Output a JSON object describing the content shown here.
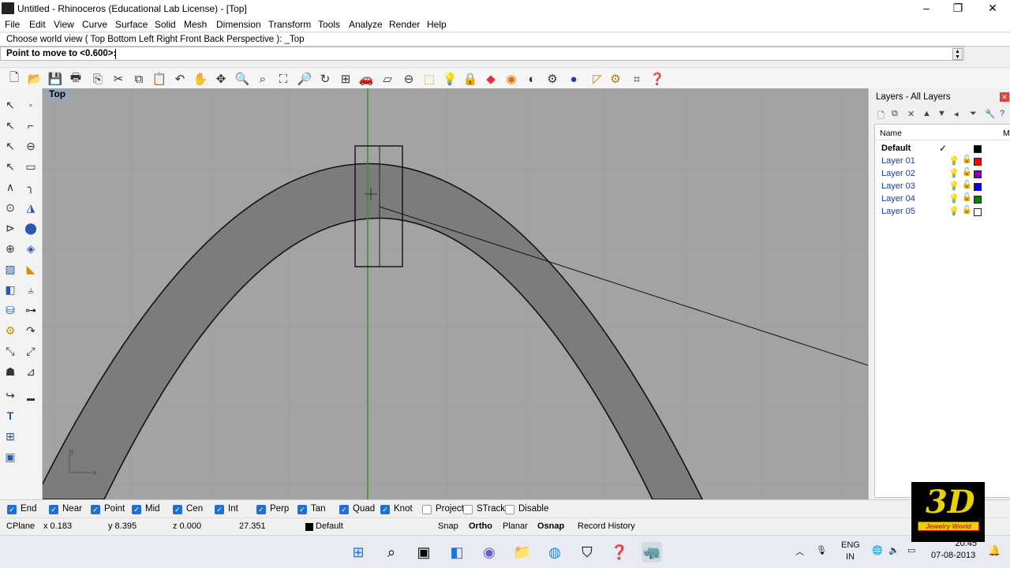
{
  "window": {
    "title": "Untitled - Rhinoceros (Educational Lab License) - [Top]",
    "controls": [
      "–",
      "❐",
      "✕"
    ]
  },
  "menu": [
    "File",
    "Edit",
    "View",
    "Curve",
    "Surface",
    "Solid",
    "Mesh",
    "Dimension",
    "Transform",
    "Tools",
    "Analyze",
    "Render",
    "Help"
  ],
  "command": {
    "history": "Choose world view ( Top  Bottom  Left  Right  Front  Back  Perspective ): _Top",
    "prompt": "Point to move to <0.600>:",
    "value": ""
  },
  "toolbar_icons": [
    "new-file-icon",
    "open-file-icon",
    "save-icon",
    "print-icon",
    "import-icon",
    "cut-icon",
    "copy-icon",
    "paste-icon",
    "undo-icon",
    "pan-hand-icon",
    "rotate-view-icon",
    "zoom-dynamic-icon",
    "zoom-window-icon",
    "zoom-extents-icon",
    "zoom-selected-icon",
    "rotate-icon",
    "viewport-layout-icon",
    "car-icon",
    "wireframe-icon",
    "construction-plane-icon",
    "snap-grid-icon",
    "light-bulb-icon",
    "lock-icon",
    "layer-icon",
    "color-wheel-icon",
    "display-mode-icon",
    "render-settings-icon",
    "render-sphere-icon",
    "text-tool-icon",
    "settings-gear-icon",
    "options-icon",
    "help-icon"
  ],
  "viewport": {
    "label": "Top",
    "axis_labels": {
      "y": "y",
      "x": "x"
    }
  },
  "layers_panel": {
    "title": "Layers - All Layers",
    "column_name": "Name",
    "column_material": "M",
    "layers": [
      {
        "name": "Default",
        "current": true,
        "check": "✓",
        "color": "#000000"
      },
      {
        "name": "Layer 01",
        "current": false,
        "color": "#ff0000"
      },
      {
        "name": "Layer 02",
        "current": false,
        "color": "#8000c0"
      },
      {
        "name": "Layer 03",
        "current": false,
        "color": "#0000ff"
      },
      {
        "name": "Layer 04",
        "current": false,
        "color": "#008000"
      },
      {
        "name": "Layer 05",
        "current": false,
        "color": "#ffffff"
      }
    ]
  },
  "osnaps": [
    {
      "label": "End",
      "checked": true
    },
    {
      "label": "Near",
      "checked": true
    },
    {
      "label": "Point",
      "checked": true
    },
    {
      "label": "Mid",
      "checked": true
    },
    {
      "label": "Cen",
      "checked": true
    },
    {
      "label": "Int",
      "checked": true
    },
    {
      "label": "Perp",
      "checked": true
    },
    {
      "label": "Tan",
      "checked": true
    },
    {
      "label": "Quad",
      "checked": true
    },
    {
      "label": "Knot",
      "checked": true
    },
    {
      "label": "Project",
      "checked": false
    },
    {
      "label": "STrack",
      "checked": false
    },
    {
      "label": "Disable",
      "checked": false
    }
  ],
  "status": {
    "cplane": "CPlane",
    "x": "x 0.183",
    "y": "y 8.395",
    "z": "z 0.000",
    "distance": "27.351",
    "layer": "Default",
    "snap": "Snap",
    "ortho": "Ortho",
    "planar": "Planar",
    "osnap": "Osnap",
    "record_history": "Record History"
  },
  "taskbar": {
    "apps": [
      "windows-start-icon",
      "search-icon",
      "task-view-icon",
      "widgets-icon",
      "chat-icon",
      "file-explorer-icon",
      "edge-browser-icon",
      "store-icon",
      "help-icon",
      "rhino-app-icon"
    ],
    "lang_top": "ENG",
    "lang_bottom": "IN",
    "time": "20:45",
    "date": "07-08-2013"
  },
  "brand": {
    "logo_text": "3D",
    "tagline": "Jewelry World"
  },
  "colors": {
    "viewport_bg": "#a3a3a3",
    "shank_fill": "#7c7c7c",
    "y_axis": "#2a9a2a",
    "checkbox_blue": "#1f6fd6"
  }
}
